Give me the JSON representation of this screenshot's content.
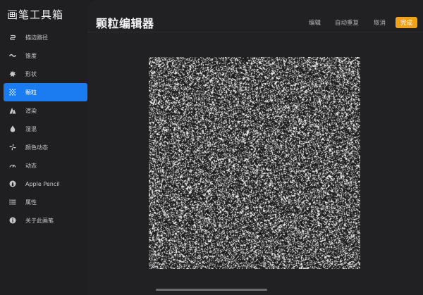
{
  "sidebar": {
    "title": "画笔工具箱",
    "items": [
      {
        "label": "描边路径",
        "icon": "stroke-path-icon",
        "active": false
      },
      {
        "label": "锥度",
        "icon": "taper-icon",
        "active": false
      },
      {
        "label": "形状",
        "icon": "shape-icon",
        "active": false
      },
      {
        "label": "颗粒",
        "icon": "grain-icon",
        "active": true
      },
      {
        "label": "渲染",
        "icon": "rendering-icon",
        "active": false
      },
      {
        "label": "湿混",
        "icon": "wet-mix-icon",
        "active": false
      },
      {
        "label": "颜色动态",
        "icon": "color-dynamics-icon",
        "active": false
      },
      {
        "label": "动态",
        "icon": "dynamics-icon",
        "active": false
      },
      {
        "label": "Apple Pencil",
        "icon": "apple-pencil-icon",
        "active": false
      },
      {
        "label": "属性",
        "icon": "properties-icon",
        "active": false
      },
      {
        "label": "关于此画笔",
        "icon": "info-icon",
        "active": false
      }
    ]
  },
  "header": {
    "title": "颗粒编辑器",
    "edit_label": "编辑",
    "auto_repeat_label": "自动重复",
    "cancel_label": "取消",
    "done_label": "完成"
  },
  "colors": {
    "accent_blue": "#1a7cf0",
    "done_orange": "#f0a31a",
    "background": "#1b1b1d",
    "panel": "#212123"
  }
}
